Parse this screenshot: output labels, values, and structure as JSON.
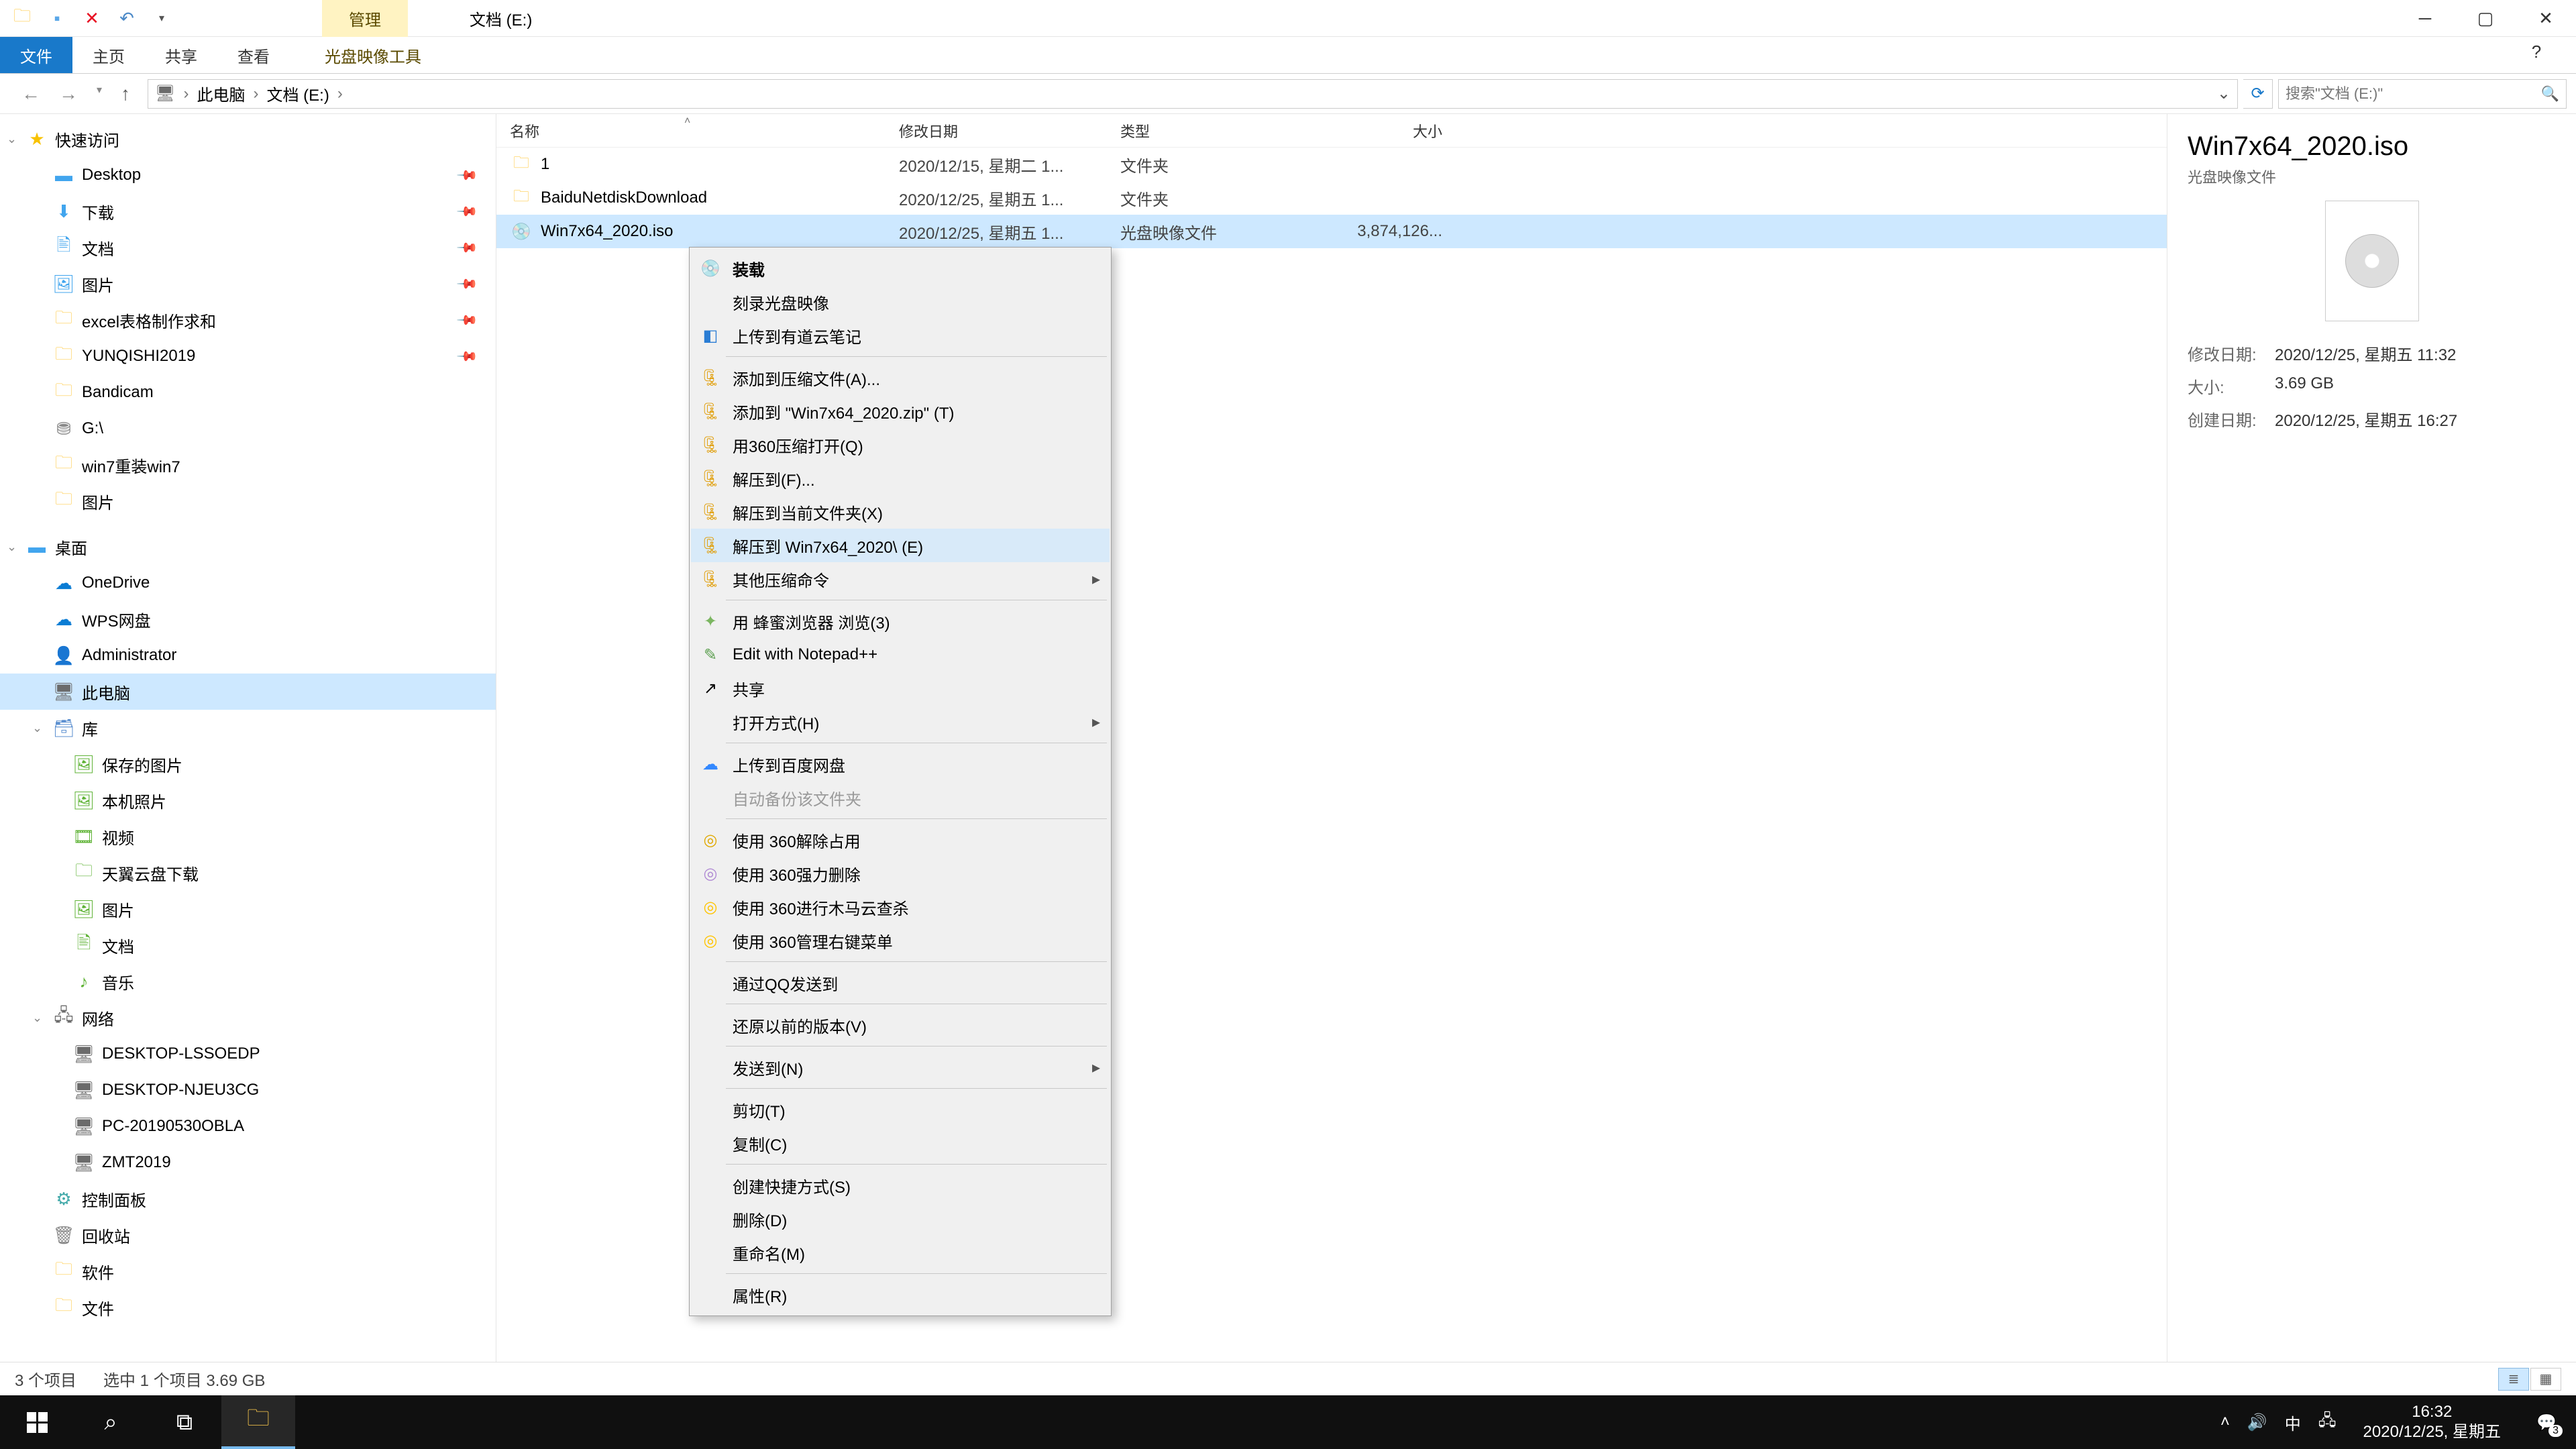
{
  "titlebar": {
    "ctx_tab": "管理",
    "location": "文档 (E:)"
  },
  "ribbon": {
    "file": "文件",
    "home": "主页",
    "share": "共享",
    "view": "查看",
    "ctx": "光盘映像工具"
  },
  "breadcrumb": {
    "root": "此电脑",
    "folder": "文档 (E:)"
  },
  "search": {
    "placeholder": "搜索\"文档 (E:)\""
  },
  "sidebar": {
    "quick": "快速访问",
    "items1": [
      {
        "label": "Desktop"
      },
      {
        "label": "下载"
      },
      {
        "label": "文档"
      },
      {
        "label": "图片"
      },
      {
        "label": "excel表格制作求和"
      },
      {
        "label": "YUNQISHI2019"
      },
      {
        "label": "Bandicam"
      },
      {
        "label": "G:\\"
      },
      {
        "label": "win7重装win7"
      },
      {
        "label": "图片"
      }
    ],
    "desktop_header": "桌面",
    "onedrive": "OneDrive",
    "wps": "WPS网盘",
    "admin": "Administrator",
    "pc": "此电脑",
    "lib": "库",
    "lib_items": [
      {
        "label": "保存的图片"
      },
      {
        "label": "本机照片"
      },
      {
        "label": "视频"
      },
      {
        "label": "天翼云盘下载"
      },
      {
        "label": "图片"
      },
      {
        "label": "文档"
      },
      {
        "label": "音乐"
      }
    ],
    "network": "网络",
    "net_items": [
      {
        "label": "DESKTOP-LSSOEDP"
      },
      {
        "label": "DESKTOP-NJEU3CG"
      },
      {
        "label": "PC-20190530OBLA"
      },
      {
        "label": "ZMT2019"
      }
    ],
    "ctrlpanel": "控制面板",
    "recycle": "回收站",
    "soft": "软件",
    "files": "文件"
  },
  "columns": {
    "name": "名称",
    "mod": "修改日期",
    "type": "类型",
    "size": "大小"
  },
  "rows": [
    {
      "name": "1",
      "mod": "2020/12/15, 星期二 1...",
      "type": "文件夹",
      "size": ""
    },
    {
      "name": "BaiduNetdiskDownload",
      "mod": "2020/12/25, 星期五 1...",
      "type": "文件夹",
      "size": ""
    },
    {
      "name": "Win7x64_2020.iso",
      "mod": "2020/12/25, 星期五 1...",
      "type": "光盘映像文件",
      "size": "3,874,126..."
    }
  ],
  "ctx": {
    "mount": "装载",
    "burn": "刻录光盘映像",
    "youdao": "上传到有道云笔记",
    "addarch": "添加到压缩文件(A)...",
    "addzip": "添加到 \"Win7x64_2020.zip\" (T)",
    "open360": "用360压缩打开(Q)",
    "extractto": "解压到(F)...",
    "extracthere": "解压到当前文件夹(X)",
    "extractfolder": "解压到 Win7x64_2020\\ (E)",
    "othercomp": "其他压缩命令",
    "honey": "用 蜂蜜浏览器 浏览(3)",
    "npp": "Edit with Notepad++",
    "share": "共享",
    "openwith": "打开方式(H)",
    "baidu": "上传到百度网盘",
    "autobackup": "自动备份该文件夹",
    "unlock": "使用 360解除占用",
    "forcedel": "使用 360强力删除",
    "trojan": "使用 360进行木马云查杀",
    "managectx": "使用 360管理右键菜单",
    "qq": "通过QQ发送到",
    "restore": "还原以前的版本(V)",
    "sendto": "发送到(N)",
    "cut": "剪切(T)",
    "copy": "复制(C)",
    "shortcut": "创建快捷方式(S)",
    "delete": "删除(D)",
    "rename": "重命名(M)",
    "props": "属性(R)"
  },
  "details": {
    "title": "Win7x64_2020.iso",
    "type": "光盘映像文件",
    "mod_k": "修改日期:",
    "mod_v": "2020/12/25, 星期五 11:32",
    "size_k": "大小:",
    "size_v": "3.69 GB",
    "create_k": "创建日期:",
    "create_v": "2020/12/25, 星期五 16:27"
  },
  "status": {
    "count": "3 个项目",
    "sel": "选中 1 个项目  3.69 GB"
  },
  "tray": {
    "ime": "中",
    "time": "16:32",
    "date": "2020/12/25, 星期五",
    "notif": "3"
  }
}
